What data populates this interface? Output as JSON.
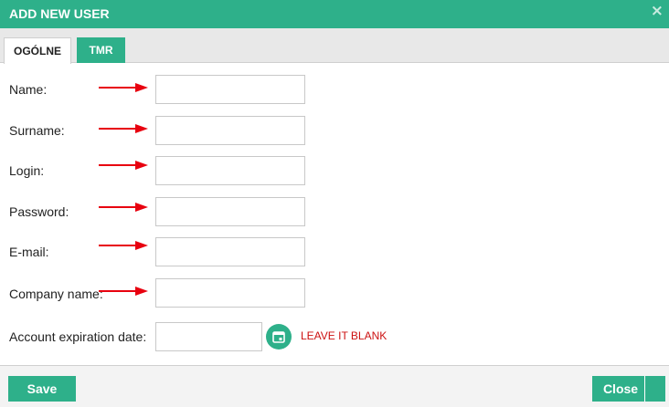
{
  "dialog": {
    "title": "ADD NEW USER",
    "close_glyph": "×"
  },
  "tabs": [
    {
      "label": "OGÓLNE",
      "active": true
    },
    {
      "label": "TMR",
      "active": false
    }
  ],
  "form": {
    "name_label": "Name:",
    "surname_label": "Surname:",
    "login_label": "Login:",
    "password_label": "Password:",
    "email_label": "E-mail:",
    "company_label": "Company name:",
    "expiration_label": "Account expiration date:",
    "name_value": "",
    "surname_value": "",
    "login_value": "",
    "password_value": "",
    "email_value": "",
    "company_value": "",
    "expiration_value": "",
    "expiration_note": "LEAVE IT BLANK"
  },
  "footer": {
    "save_label": "Save",
    "close_label": "Close"
  },
  "colors": {
    "accent": "#2eb08a",
    "annotation": "#e8000f",
    "note": "#cc1111"
  },
  "icons": {
    "calendar": "calendar-icon",
    "arrow": "red-arrow-icon"
  }
}
